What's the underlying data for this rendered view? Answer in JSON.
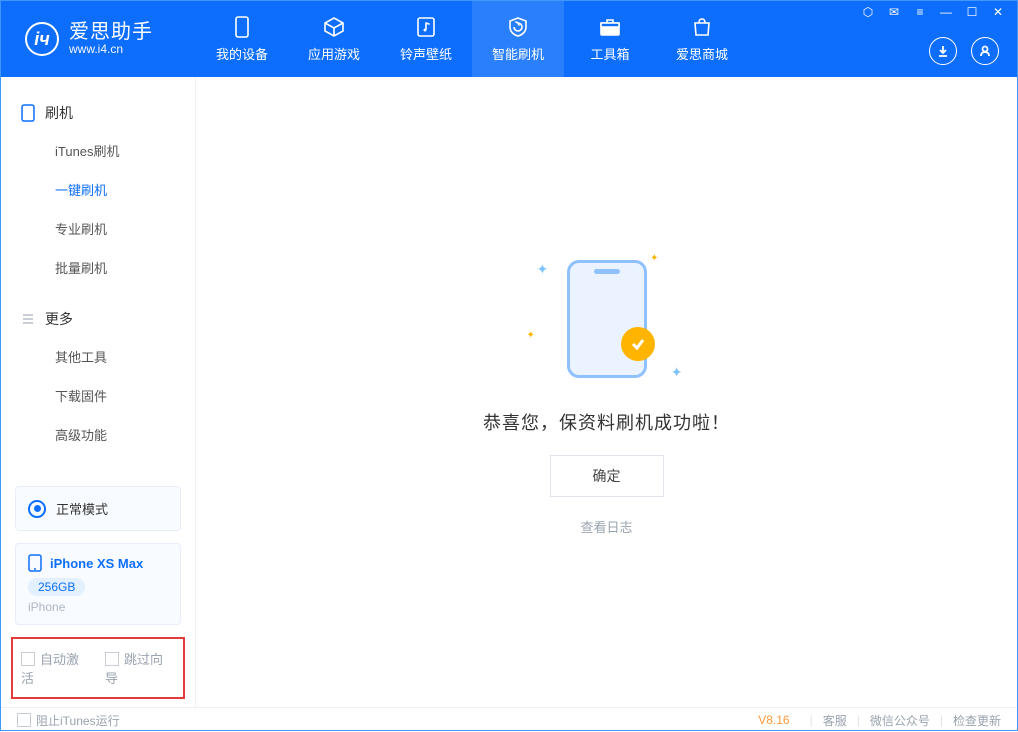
{
  "app": {
    "name_cn": "爱思助手",
    "name_en": "www.i4.cn"
  },
  "nav": {
    "tabs": [
      {
        "label": "我的设备"
      },
      {
        "label": "应用游戏"
      },
      {
        "label": "铃声壁纸"
      },
      {
        "label": "智能刷机"
      },
      {
        "label": "工具箱"
      },
      {
        "label": "爱思商城"
      }
    ],
    "active_index": 3
  },
  "sidebar": {
    "group1_title": "刷机",
    "group1_items": [
      {
        "label": "iTunes刷机"
      },
      {
        "label": "一键刷机"
      },
      {
        "label": "专业刷机"
      },
      {
        "label": "批量刷机"
      }
    ],
    "active_item_index": 1,
    "group2_title": "更多",
    "group2_items": [
      {
        "label": "其他工具"
      },
      {
        "label": "下载固件"
      },
      {
        "label": "高级功能"
      }
    ],
    "status_mode": "正常模式",
    "device": {
      "name": "iPhone XS Max",
      "capacity": "256GB",
      "type": "iPhone"
    },
    "options": {
      "auto_activate": "自动激活",
      "skip_guide": "跳过向导"
    }
  },
  "content": {
    "success_message": "恭喜您，保资料刷机成功啦！",
    "confirm_label": "确定",
    "view_log_label": "查看日志"
  },
  "footer": {
    "block_itunes": "阻止iTunes运行",
    "version": "V8.16",
    "links": {
      "support": "客服",
      "wechat": "微信公众号",
      "update": "检查更新"
    }
  }
}
